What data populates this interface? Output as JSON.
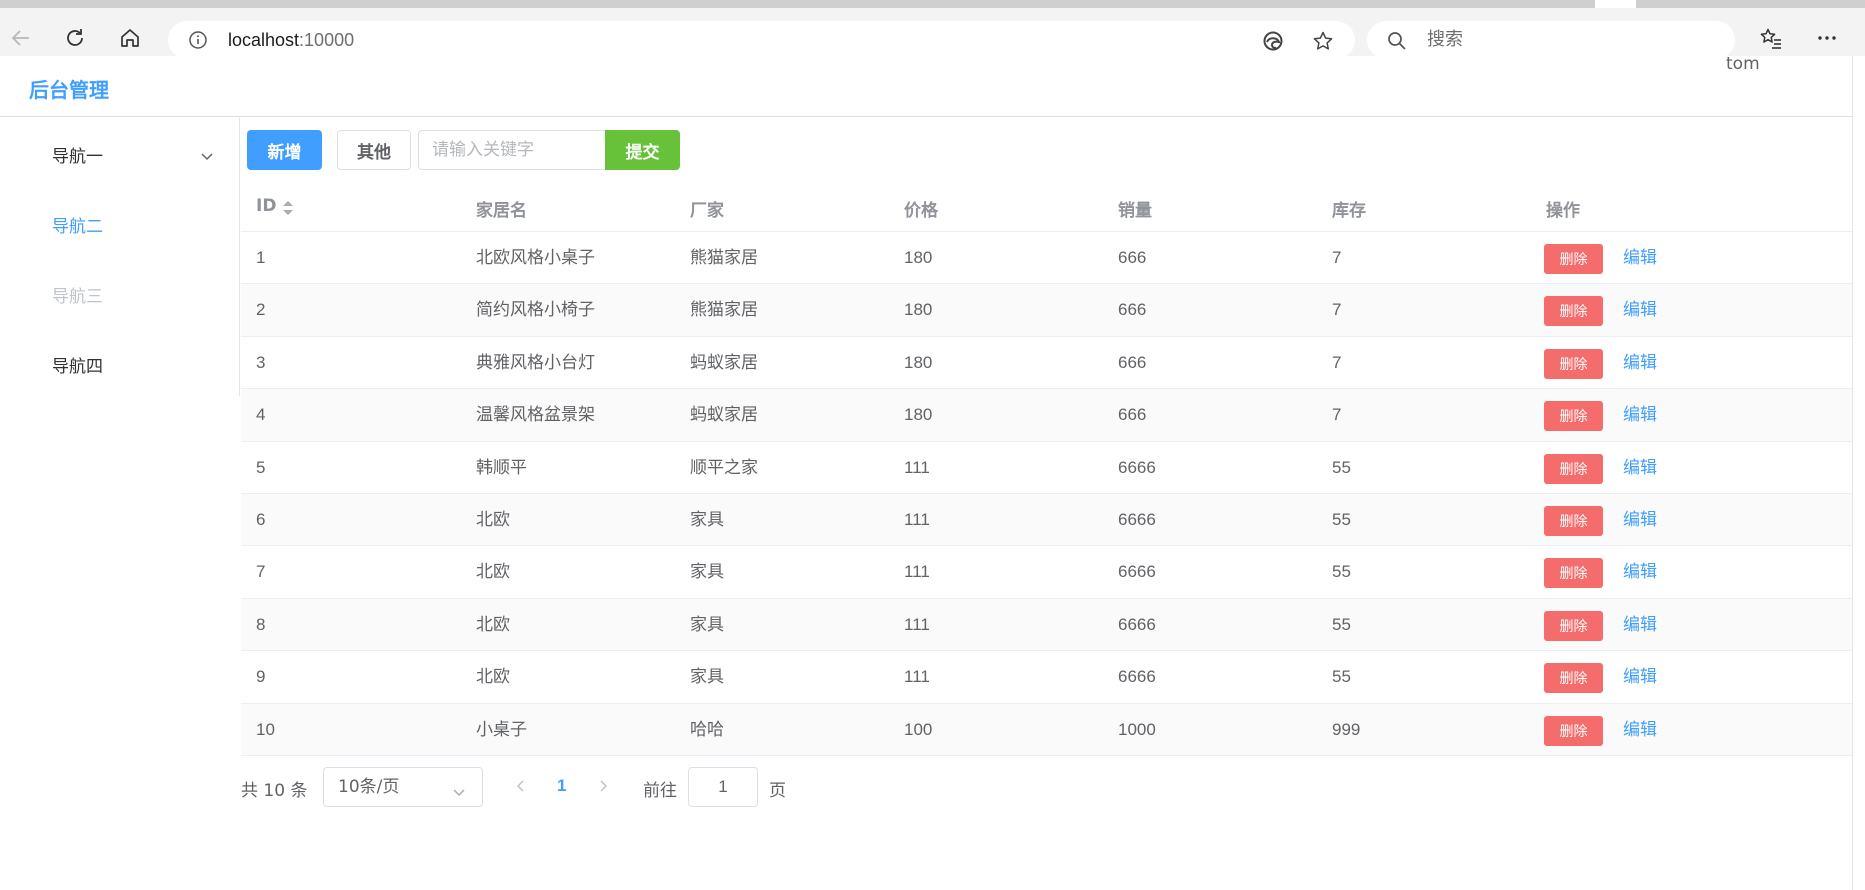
{
  "browser": {
    "url_host": "localhost",
    "url_port": ":10000",
    "search_placeholder": "搜索"
  },
  "header": {
    "title": "后台管理",
    "user": "tom"
  },
  "sidebar": {
    "items": [
      {
        "label": "导航一",
        "state": "collapsible",
        "color": "#303133"
      },
      {
        "label": "导航二",
        "state": "active",
        "color": "#409eff"
      },
      {
        "label": "导航三",
        "state": "disabled",
        "color": "#c0c4cc"
      },
      {
        "label": "导航四",
        "state": "normal",
        "color": "#303133"
      }
    ]
  },
  "toolbar": {
    "add_label": "新增",
    "other_label": "其他",
    "keyword_placeholder": "请输入关键字",
    "keyword_value": "",
    "submit_label": "提交"
  },
  "table": {
    "columns": [
      "ID",
      "家居名",
      "厂家",
      "价格",
      "销量",
      "库存",
      "操作"
    ],
    "delete_label": "删除",
    "edit_label": "编辑",
    "rows": [
      {
        "id": "1",
        "name": "北欧风格小桌子",
        "maker": "熊猫家居",
        "price": "180",
        "sales": "666",
        "stock": "7"
      },
      {
        "id": "2",
        "name": "简约风格小椅子",
        "maker": "熊猫家居",
        "price": "180",
        "sales": "666",
        "stock": "7"
      },
      {
        "id": "3",
        "name": "典雅风格小台灯",
        "maker": "蚂蚁家居",
        "price": "180",
        "sales": "666",
        "stock": "7"
      },
      {
        "id": "4",
        "name": "温馨风格盆景架",
        "maker": "蚂蚁家居",
        "price": "180",
        "sales": "666",
        "stock": "7"
      },
      {
        "id": "5",
        "name": "韩顺平",
        "maker": "顺平之家",
        "price": "111",
        "sales": "6666",
        "stock": "55"
      },
      {
        "id": "6",
        "name": "北欧",
        "maker": "家具",
        "price": "111",
        "sales": "6666",
        "stock": "55"
      },
      {
        "id": "7",
        "name": "北欧",
        "maker": "家具",
        "price": "111",
        "sales": "6666",
        "stock": "55"
      },
      {
        "id": "8",
        "name": "北欧",
        "maker": "家具",
        "price": "111",
        "sales": "6666",
        "stock": "55"
      },
      {
        "id": "9",
        "name": "北欧",
        "maker": "家具",
        "price": "111",
        "sales": "6666",
        "stock": "55"
      },
      {
        "id": "10",
        "name": "小桌子",
        "maker": "哈哈",
        "price": "100",
        "sales": "1000",
        "stock": "999"
      }
    ]
  },
  "pagination": {
    "total_text": "共 10 条",
    "page_size": "10条/页",
    "current_page": "1",
    "goto_label": "前往",
    "goto_value": "1",
    "page_unit": "页"
  },
  "colors": {
    "primary": "#409eff",
    "success": "#67c23a",
    "danger": "#f56c6c"
  }
}
